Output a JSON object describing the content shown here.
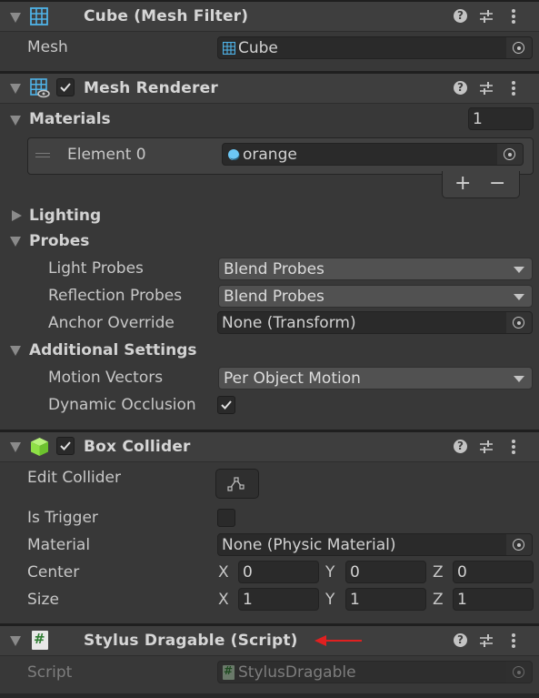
{
  "components": {
    "mesh_filter": {
      "title": "Cube (Mesh Filter)",
      "mesh_label": "Mesh",
      "mesh_value": "Cube"
    },
    "mesh_renderer": {
      "title": "Mesh Renderer",
      "enabled": true,
      "materials_label": "Materials",
      "materials_count": "1",
      "elements": [
        {
          "label": "Element 0",
          "value": "orange"
        }
      ],
      "add_label": "+",
      "remove_label": "−",
      "lighting_label": "Lighting",
      "probes_label": "Probes",
      "light_probes_label": "Light Probes",
      "light_probes_value": "Blend Probes",
      "reflection_probes_label": "Reflection Probes",
      "reflection_probes_value": "Blend Probes",
      "anchor_override_label": "Anchor Override",
      "anchor_override_value": "None (Transform)",
      "additional_settings_label": "Additional Settings",
      "motion_vectors_label": "Motion Vectors",
      "motion_vectors_value": "Per Object Motion",
      "dynamic_occlusion_label": "Dynamic Occlusion",
      "dynamic_occlusion": true
    },
    "box_collider": {
      "title": "Box Collider",
      "enabled": true,
      "edit_collider_label": "Edit Collider",
      "is_trigger_label": "Is Trigger",
      "is_trigger": false,
      "material_label": "Material",
      "material_value": "None (Physic Material)",
      "center_label": "Center",
      "center": {
        "x": "0",
        "y": "0",
        "z": "0"
      },
      "size_label": "Size",
      "size": {
        "x": "1",
        "y": "1",
        "z": "1"
      },
      "axis_labels": {
        "x": "X",
        "y": "Y",
        "z": "Z"
      }
    },
    "stylus_dragable": {
      "title": "Stylus Dragable (Script)",
      "script_label": "Script",
      "script_value": "StylusDragable"
    }
  },
  "icons": {
    "help": "?",
    "presets": "presets-sliders-icon",
    "menu": "kebab-menu-icon",
    "object_picker": "target-circle-icon"
  },
  "colors": {
    "mesh_icon": "#4fb3e8",
    "material_icon": "#6cc7f5",
    "collider_icon": "#8ee046",
    "script_icon_bg": "#e8e8e8",
    "script_icon_hash": "#2e7d32",
    "annotation_arrow": "#e02020"
  }
}
